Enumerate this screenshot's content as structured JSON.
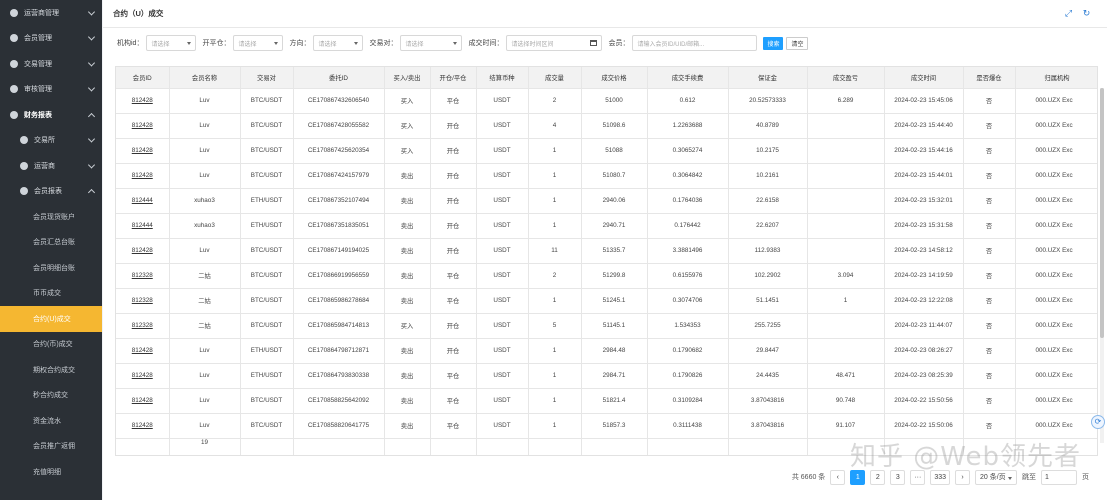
{
  "sidebar": {
    "items": [
      {
        "label": "运营商管理",
        "level": 1,
        "expanded": false
      },
      {
        "label": "会员管理",
        "level": 1,
        "expanded": false
      },
      {
        "label": "交易管理",
        "level": 1,
        "expanded": false
      },
      {
        "label": "审核管理",
        "level": 1,
        "expanded": false
      },
      {
        "label": "财务报表",
        "level": 1,
        "expanded": true
      },
      {
        "label": "交易所",
        "level": 2,
        "expanded": false
      },
      {
        "label": "运营商",
        "level": 2,
        "expanded": false
      },
      {
        "label": "会员报表",
        "level": 2,
        "expanded": true
      },
      {
        "label": "会员现货账户",
        "level": 3
      },
      {
        "label": "会员汇总台账",
        "level": 3
      },
      {
        "label": "会员明细台账",
        "level": 3
      },
      {
        "label": "币币成交",
        "level": 3
      },
      {
        "label": "合约(U)成交",
        "level": 3,
        "active": true
      },
      {
        "label": "合约(币)成交",
        "level": 3
      },
      {
        "label": "期权合约成交",
        "level": 3
      },
      {
        "label": "秒合约成交",
        "level": 3
      },
      {
        "label": "资金流水",
        "level": 3
      },
      {
        "label": "会员推广返佣",
        "level": 3
      },
      {
        "label": "充值明细",
        "level": 3
      }
    ]
  },
  "header": {
    "title": "合约（U）成交",
    "icons": [
      "expand-icon",
      "refresh-icon"
    ]
  },
  "filters": {
    "institution_label": "机构id：",
    "institution_placeholder": "请选择",
    "platform_label": "开平仓：",
    "platform_placeholder": "请选择",
    "direction_label": "方向：",
    "direction_placeholder": "请选择",
    "pair_label": "交易对：",
    "pair_placeholder": "请选择",
    "time_label": "成交时间：",
    "time_placeholder": "请选择时间区间",
    "member_label": "会员：",
    "member_placeholder": "请输入会员ID/UID/邮箱...",
    "search_label": "搜索",
    "clear_label": "清空"
  },
  "table": {
    "headers": [
      "会员ID",
      "会员名称",
      "交易对",
      "委托ID",
      "买入/卖出",
      "开仓/平仓",
      "结算币种",
      "成交量",
      "成交价格",
      "成交手续费",
      "保证金",
      "成交盈亏",
      "成交时间",
      "是否爆仓",
      "归属机构"
    ],
    "rows": [
      [
        "812428",
        "Luv",
        "BTC/USDT",
        "CE170867432606540",
        "买入",
        "平仓",
        "USDT",
        "2",
        "51000",
        "0.612",
        "20.52573333",
        "6.289",
        "2024-02-23 15:45:06",
        "否",
        "000.UZX Exc"
      ],
      [
        "812428",
        "Luv",
        "BTC/USDT",
        "CE170867428055582",
        "买入",
        "开仓",
        "USDT",
        "4",
        "51098.6",
        "1.2263688",
        "40.8789",
        "",
        "2024-02-23 15:44:40",
        "否",
        "000.UZX Exc"
      ],
      [
        "812428",
        "Luv",
        "BTC/USDT",
        "CE170867425620354",
        "买入",
        "开仓",
        "USDT",
        "1",
        "51088",
        "0.3065274",
        "10.2175",
        "",
        "2024-02-23 15:44:16",
        "否",
        "000.UZX Exc"
      ],
      [
        "812428",
        "Luv",
        "BTC/USDT",
        "CE170867424157979",
        "卖出",
        "开仓",
        "USDT",
        "1",
        "51080.7",
        "0.3064842",
        "10.2161",
        "",
        "2024-02-23 15:44:01",
        "否",
        "000.UZX Exc"
      ],
      [
        "812444",
        "xuhao3",
        "ETH/USDT",
        "CE170867352107494",
        "卖出",
        "开仓",
        "USDT",
        "1",
        "2940.06",
        "0.1764036",
        "22.6158",
        "",
        "2024-02-23 15:32:01",
        "否",
        "000.UZX Exc"
      ],
      [
        "812444",
        "xuhao3",
        "ETH/USDT",
        "CE170867351835051",
        "卖出",
        "开仓",
        "USDT",
        "1",
        "2940.71",
        "0.176442",
        "22.6207",
        "",
        "2024-02-23 15:31:58",
        "否",
        "000.UZX Exc"
      ],
      [
        "812428",
        "Luv",
        "BTC/USDT",
        "CE170867149194025",
        "卖出",
        "开仓",
        "USDT",
        "11",
        "51335.7",
        "3.3881496",
        "112.9383",
        "",
        "2024-02-23 14:58:12",
        "否",
        "000.UZX Exc"
      ],
      [
        "812328",
        "二姑",
        "BTC/USDT",
        "CE170866919956559",
        "卖出",
        "平仓",
        "USDT",
        "2",
        "51299.8",
        "0.6155976",
        "102.2902",
        "3.094",
        "2024-02-23 14:19:59",
        "否",
        "000.UZX Exc"
      ],
      [
        "812328",
        "二姑",
        "BTC/USDT",
        "CE170865986278684",
        "卖出",
        "平仓",
        "USDT",
        "1",
        "51245.1",
        "0.3074706",
        "51.1451",
        "1",
        "2024-02-23 12:22:08",
        "否",
        "000.UZX Exc"
      ],
      [
        "812328",
        "二姑",
        "BTC/USDT",
        "CE170865984714813",
        "买入",
        "开仓",
        "USDT",
        "5",
        "51145.1",
        "1.534353",
        "255.7255",
        "",
        "2024-02-23 11:44:07",
        "否",
        "000.UZX Exc"
      ],
      [
        "812428",
        "Luv",
        "ETH/USDT",
        "CE170864798712871",
        "卖出",
        "开仓",
        "USDT",
        "1",
        "2984.48",
        "0.1790682",
        "29.8447",
        "",
        "2024-02-23 08:26:27",
        "否",
        "000.UZX Exc"
      ],
      [
        "812428",
        "Luv",
        "ETH/USDT",
        "CE170864793830338",
        "卖出",
        "平仓",
        "USDT",
        "1",
        "2984.71",
        "0.1790826",
        "24.4435",
        "48.471",
        "2024-02-23 08:25:39",
        "否",
        "000.UZX Exc"
      ],
      [
        "812428",
        "Luv",
        "BTC/USDT",
        "CE170858825642092",
        "卖出",
        "平仓",
        "USDT",
        "1",
        "51821.4",
        "0.3109284",
        "3.87043816",
        "90.748",
        "2024-02-22 15:50:56",
        "否",
        "000.UZX Exc"
      ],
      [
        "812428",
        "Luv",
        "BTC/USDT",
        "CE170858820641775",
        "卖出",
        "平仓",
        "USDT",
        "1",
        "51857.3",
        "0.3111438",
        "3.87043816",
        "91.107",
        "2024-02-22 15:50:06",
        "否",
        "000.UZX Exc"
      ]
    ],
    "partial_row_name": "19"
  },
  "pager": {
    "total": "共 6660 条",
    "pages": [
      "1",
      "2",
      "3",
      "···",
      "333"
    ],
    "page_size": "20 条/页",
    "goto_label": "跳至",
    "goto_value": "1",
    "page_unit": "页"
  },
  "watermark": "知乎 @Web领先者"
}
